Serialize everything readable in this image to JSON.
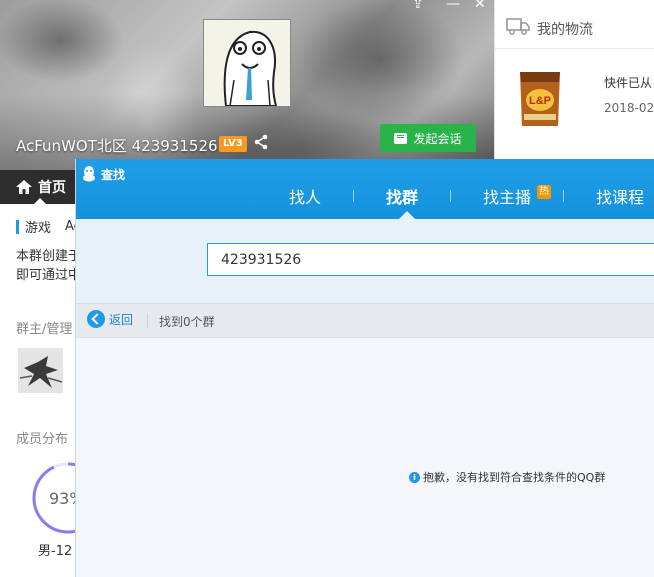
{
  "group_window": {
    "title": "AcFunWOT北区 423931526",
    "level": "LV3",
    "start_chat_label": "发起会话",
    "home_tab_label": "首页",
    "tag_label": "游戏",
    "tag_extra": "Ac",
    "intro_line1": "本群创建于",
    "intro_line2": "即可通过中",
    "admins_label": "群主/管理",
    "distribution_label": "成员分布",
    "gender_percent": "93%",
    "gender_male": "男-12",
    "gender_male_ratio": 0.93
  },
  "logistics": {
    "title": "我的物流",
    "status": "快件已从",
    "date": "2018-02-"
  },
  "search_window": {
    "title": "查找",
    "tabs": [
      {
        "label": "找人"
      },
      {
        "label": "找群"
      },
      {
        "label": "找主播"
      },
      {
        "label": "找课程"
      }
    ],
    "hot_badge": "热",
    "selected_tab": "找群",
    "query": "423931526",
    "back_label": "返回",
    "result_count_text": "找到0个群",
    "empty_message": "抱歉，没有找到符合查找条件的QQ群",
    "info_icon_text": "i"
  },
  "colors": {
    "accent_blue": "#1e9be6",
    "chat_green": "#2bb34b",
    "level_orange": "#f59a23"
  }
}
